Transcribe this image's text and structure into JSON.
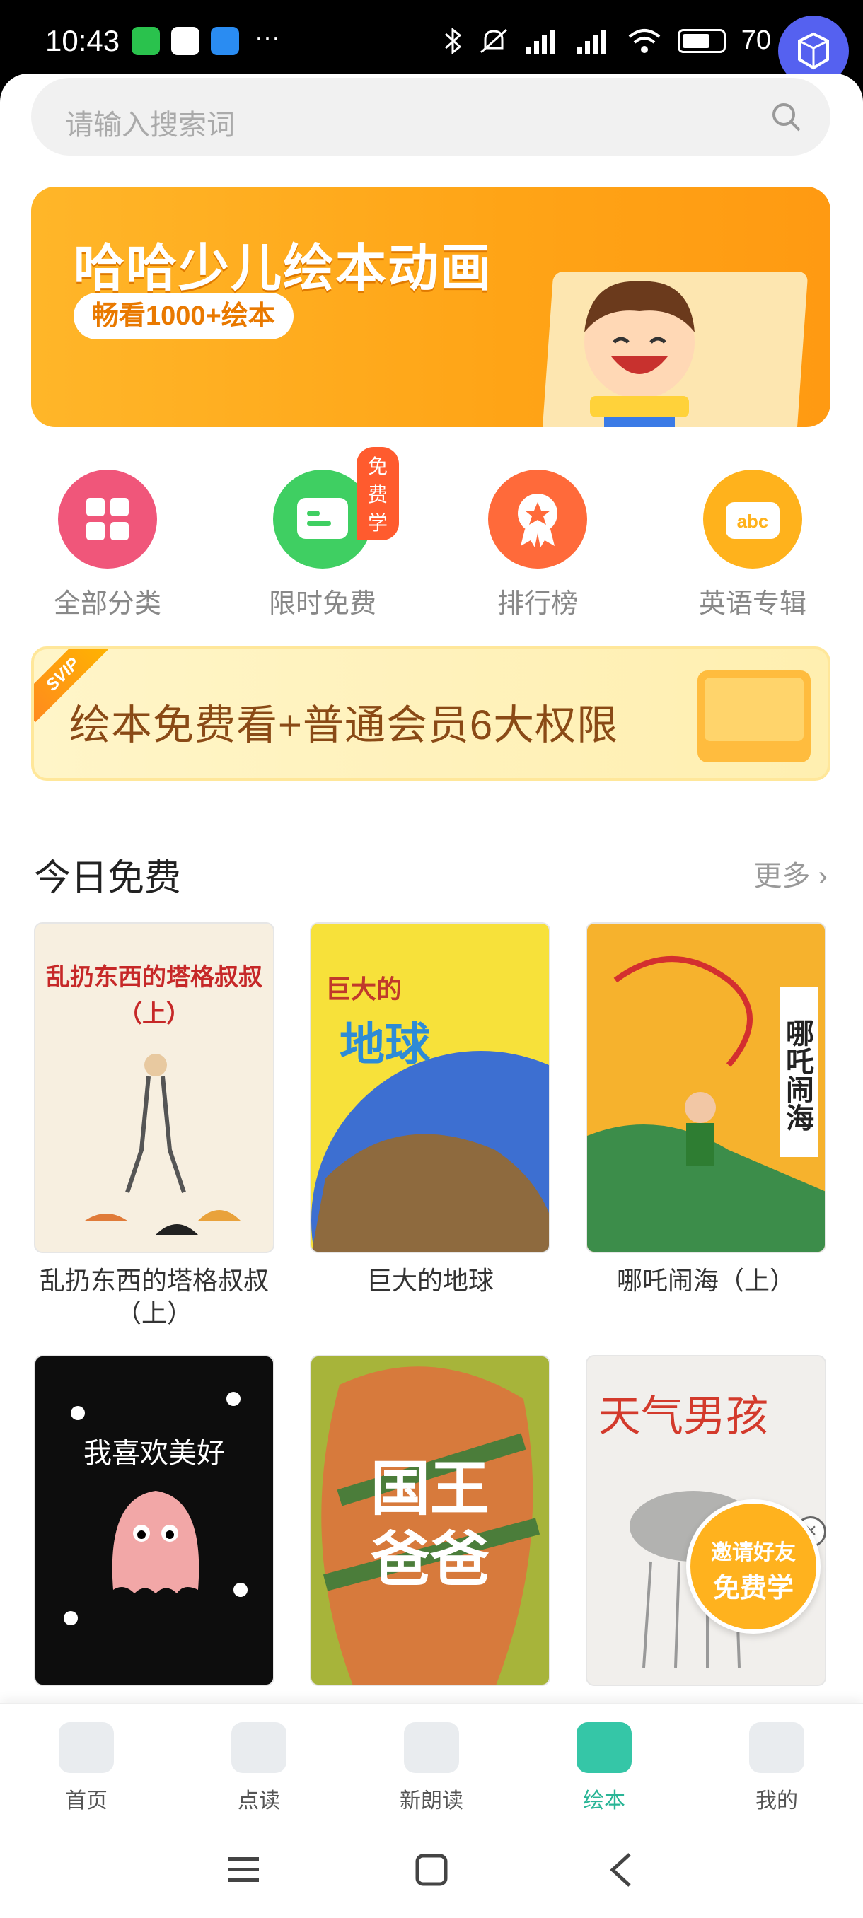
{
  "status_bar": {
    "time": "10:43",
    "battery": "70"
  },
  "search": {
    "placeholder": "请输入搜索词"
  },
  "banner": {
    "title": "哈哈少儿绘本动画",
    "pill": "畅看1000+绘本"
  },
  "categories": [
    {
      "label": "全部分类",
      "color": "#f0567a"
    },
    {
      "label": "限时免费",
      "color": "#3fcf62",
      "badge": "免费学"
    },
    {
      "label": "排行榜",
      "color": "#ff6a3a"
    },
    {
      "label": "英语专辑",
      "color": "#ffb21c"
    }
  ],
  "vip_banner": {
    "text": "绘本免费看+普通会员6大权限",
    "tag": "SVIP"
  },
  "section": {
    "title": "今日免费",
    "more": "更多"
  },
  "books": [
    {
      "title": "乱扔东西的塔格叔叔（上）",
      "cover_text": "乱扔东西的塔格叔叔",
      "cover_sub": "（上）"
    },
    {
      "title": "巨大的地球",
      "cover_text": "巨大的",
      "cover_sub": "地球"
    },
    {
      "title": "哪吒闹海（上）",
      "cover_text": "哪吒闹海",
      "cover_sub": "（上）"
    },
    {
      "title": "我喜欢美好",
      "cover_text": "我喜欢美好",
      "cover_sub": ""
    },
    {
      "title": "国王爸爸",
      "cover_text": "国王",
      "cover_sub": "爸爸"
    },
    {
      "title": "天气男孩",
      "cover_text": "天气男孩",
      "cover_sub": ""
    }
  ],
  "invite": {
    "line1": "邀请好友",
    "line2": "免费学"
  },
  "tabs": [
    {
      "label": "首页",
      "icon": "home-icon"
    },
    {
      "label": "点读",
      "icon": "point-read-icon"
    },
    {
      "label": "新朗读",
      "icon": "read-aloud-icon"
    },
    {
      "label": "绘本",
      "icon": "picture-book-icon",
      "active": true
    },
    {
      "label": "我的",
      "icon": "profile-icon"
    }
  ]
}
